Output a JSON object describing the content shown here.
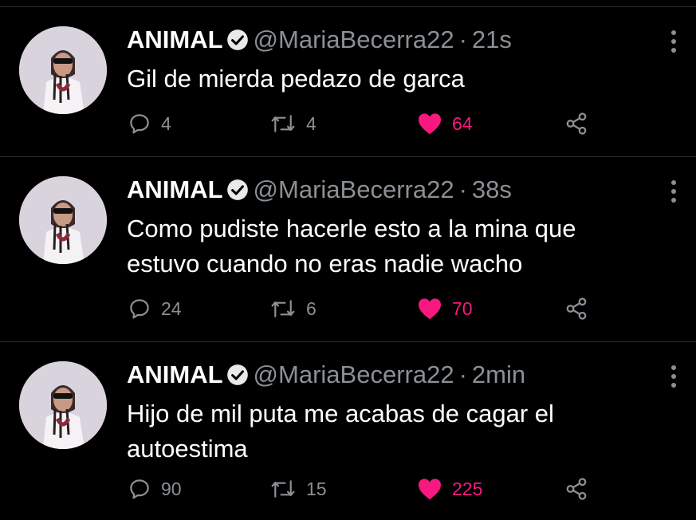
{
  "colors": {
    "background": "#000000",
    "text": "#e7e9ea",
    "muted": "#8b9095",
    "like": "#f91880"
  },
  "icons": {
    "reply": "reply-bubble-icon",
    "retweet": "retweet-arrows-icon",
    "like": "heart-icon",
    "share": "share-icon",
    "verified": "verified-badge-icon",
    "more": "more-vertical-icon"
  },
  "tweets": [
    {
      "name": "ANIMAL",
      "handle": "@MariaBecerra22",
      "separator": "·",
      "time": "21s",
      "text": "Gil de mierda pedazo de garca",
      "replies": "4",
      "retweets": "4",
      "likes": "64",
      "liked": true
    },
    {
      "name": "ANIMAL",
      "handle": "@MariaBecerra22",
      "separator": "·",
      "time": "38s",
      "text": "Como pudiste hacerle esto a la mina que estuvo cuando no eras nadie wacho",
      "replies": "24",
      "retweets": "6",
      "likes": "70",
      "liked": true
    },
    {
      "name": "ANIMAL",
      "handle": "@MariaBecerra22",
      "separator": "·",
      "time": "2min",
      "text": "Hijo de mil puta me acabas de cagar el autoestima",
      "replies": "90",
      "retweets": "15",
      "likes": "225",
      "liked": true
    }
  ]
}
